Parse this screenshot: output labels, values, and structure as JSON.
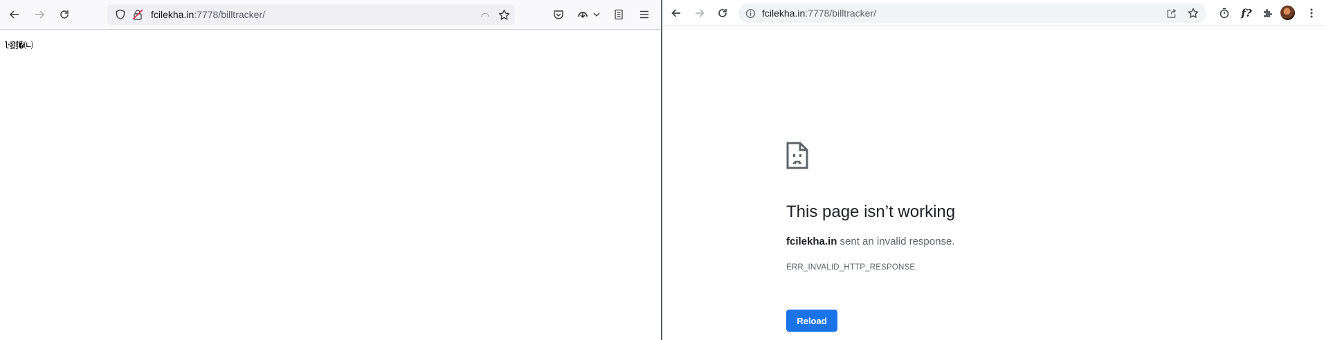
{
  "firefox": {
    "url_host": "fcilekha.in",
    "url_rest": ":7778/billtracker/",
    "page_garbage_text": "ŀ㔇ⷵ�㈁",
    "toolbar_icons": [
      "back-arrow-icon",
      "forward-arrow-icon",
      "reload-icon",
      "shield-icon",
      "insecure-lock-icon",
      "reader-view-icon",
      "star-icon",
      "pocket-icon",
      "download-icon",
      "chevron-down-icon",
      "document-icon",
      "hamburger-menu-icon"
    ]
  },
  "chrome": {
    "url_host": "fcilekha.in",
    "url_rest": ":7778/billtracker/",
    "error": {
      "title": "This page isn’t working",
      "host": "fcilekha.in",
      "message": "sent an invalid response.",
      "code": "ERR_INVALID_HTTP_RESPONSE",
      "reload_label": "Reload"
    },
    "extension_label": "f?",
    "toolbar_icons": [
      "back-arrow-icon",
      "forward-arrow-icon",
      "reload-icon",
      "info-icon",
      "share-icon",
      "star-icon",
      "timer-icon",
      "formula-extension-icon",
      "puzzle-icon",
      "avatar",
      "kebab-menu-icon"
    ]
  },
  "colors": {
    "reload_button": "#1a73e8",
    "divider": "#5f6368"
  }
}
